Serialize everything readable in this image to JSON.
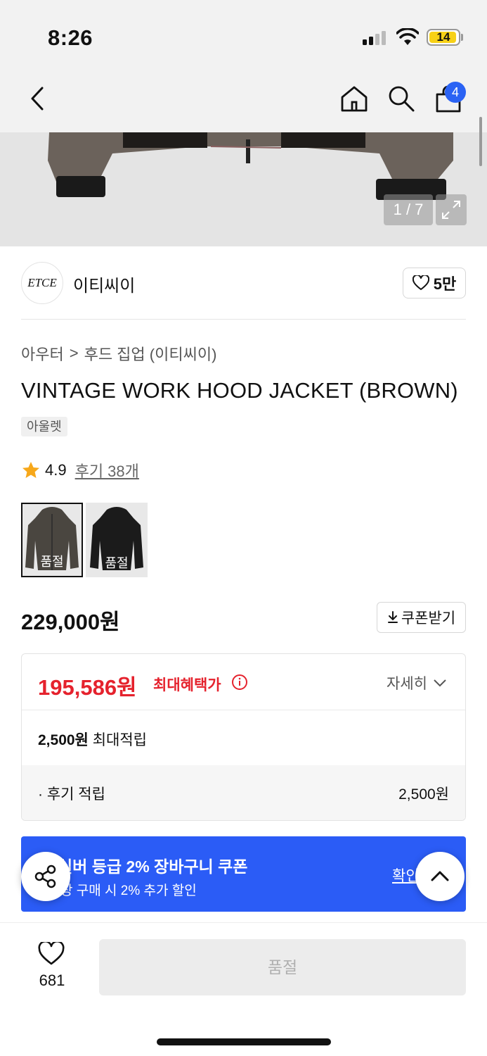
{
  "status_bar": {
    "time": "8:26",
    "battery": "14"
  },
  "nav": {
    "cart_count": "4"
  },
  "gallery": {
    "counter": "1 / 7"
  },
  "brand": {
    "logo_text": "ETCE",
    "name": "이티씨이",
    "likes": "5만"
  },
  "breadcrumb": {
    "category": "아우터",
    "separator": ">",
    "subcategory": "후드 집업 (이티씨이)"
  },
  "product": {
    "title": "VINTAGE WORK HOOD JACKET (BROWN)",
    "tag": "아울렛",
    "rating": "4.9",
    "review_link": "후기 38개",
    "options": [
      {
        "color": "brown",
        "status": "품절",
        "selected": true
      },
      {
        "color": "black",
        "status": "품절",
        "selected": false
      }
    ],
    "price": "229,000원",
    "coupon_button": "쿠폰받기"
  },
  "benefits": {
    "best_price": "195,586원",
    "best_price_label": "최대혜택가",
    "detail_toggle": "자세히",
    "points_amount": "2,500원",
    "points_label": "최대적립",
    "review_points_label": "· 후기 적립",
    "review_points_value": "2,500원"
  },
  "banner": {
    "line1": "실버 등급 2% 장바구니 쿠폰",
    "line2": "상 구매 시 2% 추가 할인",
    "confirm": "확인"
  },
  "bottom": {
    "wish_count": "681",
    "purchase_button": "품절"
  },
  "colors": {
    "accent_blue": "#2b5cf6",
    "price_red": "#e5222d",
    "star": "#f7a81b"
  }
}
